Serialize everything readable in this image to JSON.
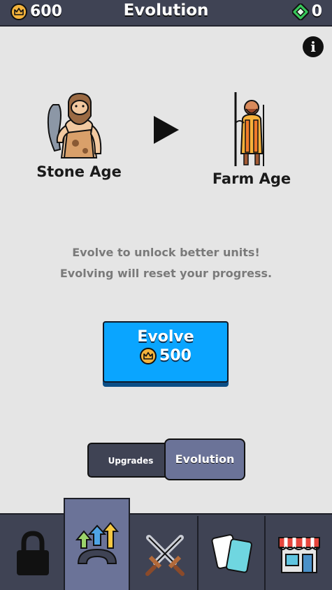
{
  "header": {
    "coins": "600",
    "title": "Evolution",
    "gems": "0"
  },
  "current_era": {
    "name": "Stone Age"
  },
  "next_era": {
    "name": "Farm Age"
  },
  "message": {
    "line1": "Evolve to unlock better units!",
    "line2": "Evolving will reset your progress."
  },
  "evolve_button": {
    "label": "Evolve",
    "cost": "500"
  },
  "segment": {
    "upgrades": "Upgrades",
    "evolution": "Evolution"
  },
  "navbar": {
    "tabs": [
      "lock-icon",
      "evolution-arrows-icon",
      "crossed-swords-icon",
      "cards-icon",
      "shop-icon"
    ],
    "active_index": 1
  },
  "colors": {
    "bar": "#3f4354",
    "active_tab": "#6b7398",
    "evolve_button": "#0aa5ff",
    "coin": "#f3b33c",
    "gem": "#37c85a"
  }
}
